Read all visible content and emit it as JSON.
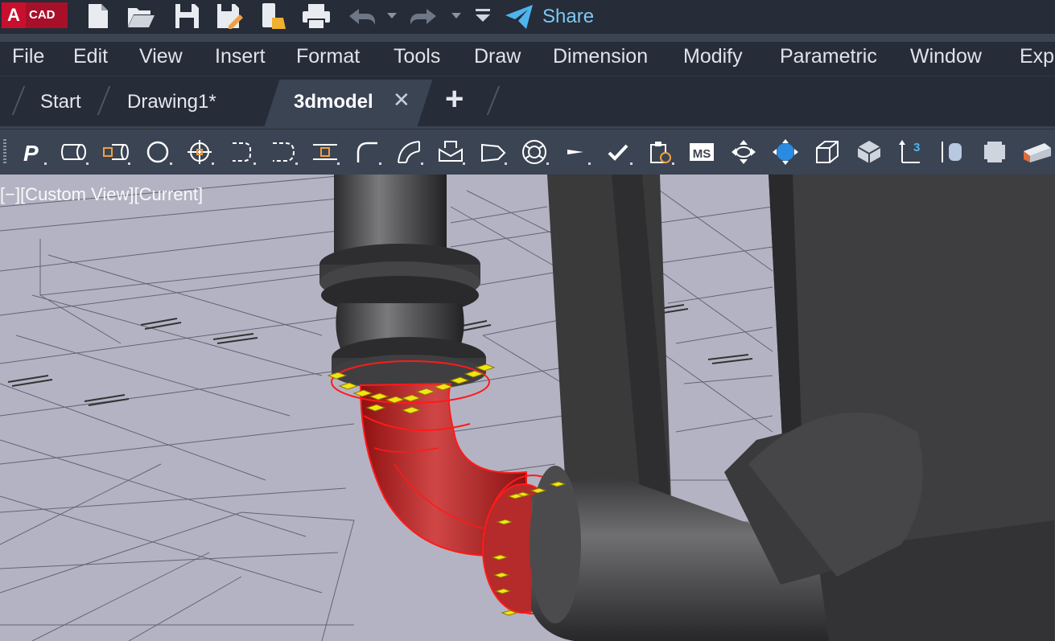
{
  "app": {
    "logo_letter": "A",
    "logo_text": "CAD"
  },
  "qat": {
    "share_label": "Share",
    "icons": [
      "new-file",
      "open-folder",
      "save",
      "save-as",
      "cloud-save",
      "print",
      "undo",
      "undo-dropdown",
      "redo",
      "redo-dropdown",
      "qat-customize",
      "share"
    ]
  },
  "menu": {
    "items": [
      "File",
      "Edit",
      "View",
      "Insert",
      "Format",
      "Tools",
      "Draw",
      "Dimension",
      "Modify",
      "Parametric",
      "Window",
      "Expr"
    ]
  },
  "tabs": {
    "items": [
      {
        "label": "Start",
        "active": false
      },
      {
        "label": "Drawing1*",
        "active": false
      },
      {
        "label": "3dmodel",
        "active": true
      }
    ],
    "close_glyph": "✕",
    "new_glyph": "+"
  },
  "toolbar": {
    "tools": [
      "polysolid",
      "cylinder-pipe",
      "pipe-fitting",
      "circle",
      "center-mark",
      "bracket",
      "arc-bracket",
      "insert-block",
      "fillet",
      "curve",
      "box-fold",
      "plane",
      "torus",
      "flag",
      "check",
      "clipboard-lock",
      "model-space",
      "orbit",
      "globe",
      "wire-box",
      "solid-box",
      "ucs-z",
      "layer-cylinder",
      "frame",
      "section-plane"
    ],
    "ms_label": "MS",
    "ucs_label": "3"
  },
  "viewport": {
    "label": "[−][Custom View][Current]",
    "background": "#b4b3c3",
    "selected_color": "#d81c1c",
    "grip_color": "#f3e414"
  }
}
